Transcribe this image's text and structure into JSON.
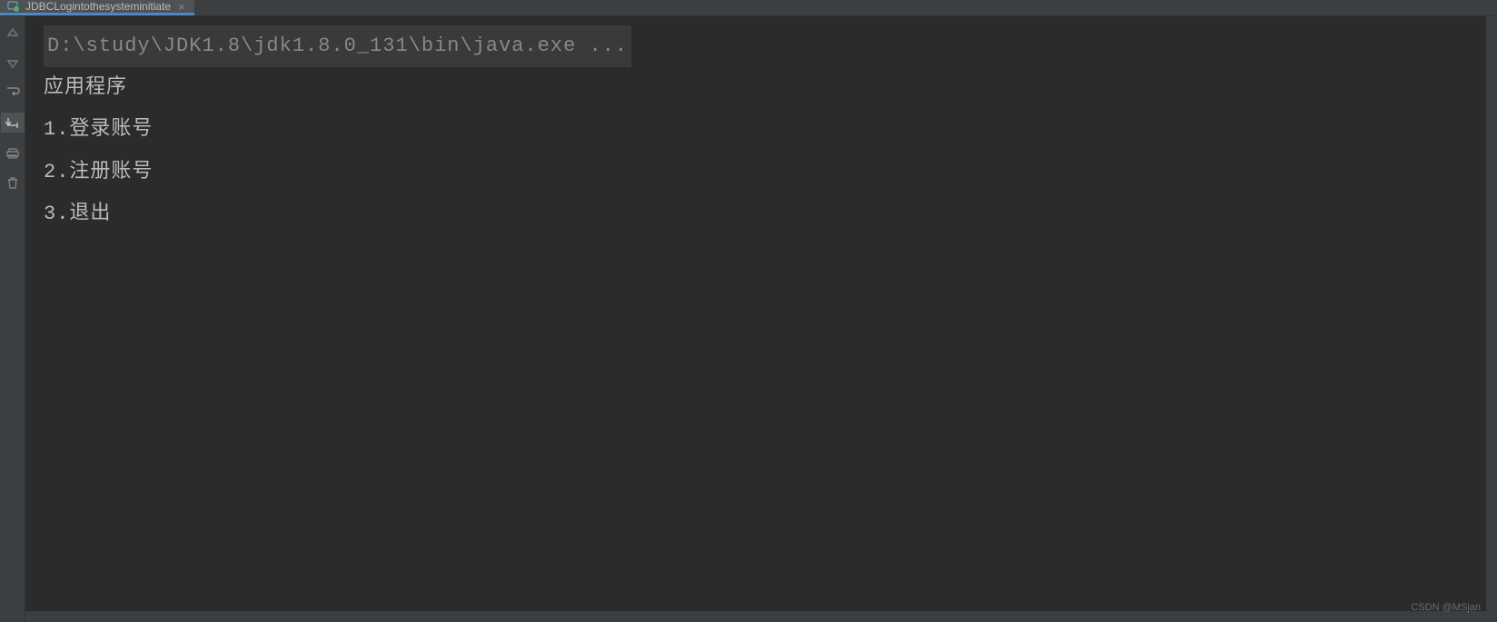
{
  "tab": {
    "title": "JDBCLogintothesysteminitiate",
    "close": "×"
  },
  "console": {
    "command": "D:\\study\\JDK1.8\\jdk1.8.0_131\\bin\\java.exe ...",
    "lines": [
      "应用程序",
      "1.登录账号",
      "2.注册账号",
      "3.退出"
    ]
  },
  "watermark": "CSDN @MSjan"
}
